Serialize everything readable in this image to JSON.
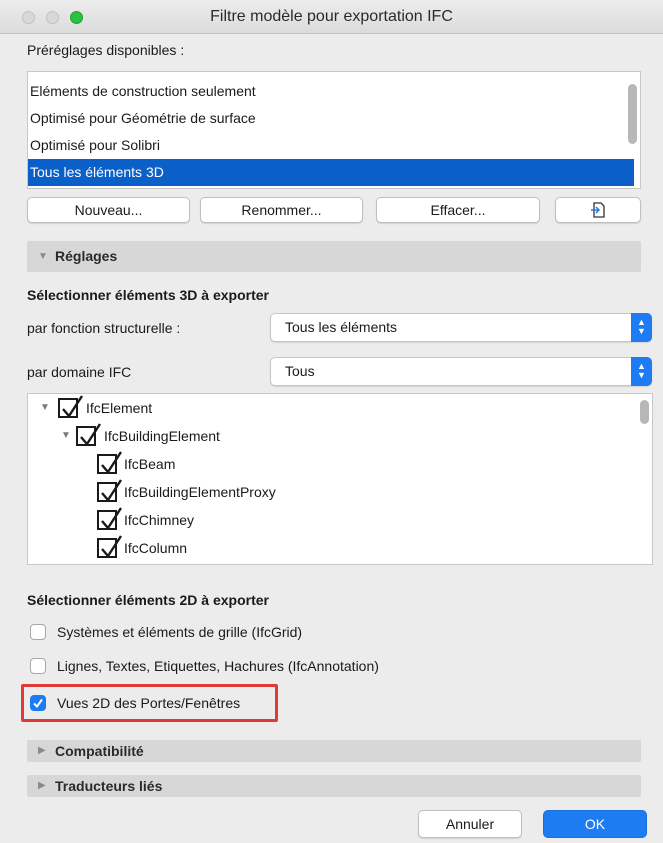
{
  "window": {
    "title": "Filtre modèle pour exportation IFC"
  },
  "presets": {
    "label": "Préréglages disponibles :",
    "items": [
      "Eléments de construction seulement",
      "Optimisé pour Géométrie de surface",
      "Optimisé pour Solibri",
      "Tous les éléments 3D"
    ],
    "selected": "Tous les éléments 3D"
  },
  "buttons": {
    "new": "Nouveau...",
    "rename": "Renommer...",
    "delete": "Effacer...",
    "import_icon": "import-icon"
  },
  "reglages": {
    "title": "Réglages",
    "expanded": true
  },
  "select3d": {
    "heading": "Sélectionner éléments 3D à exporter",
    "structural_label": "par fonction structurelle :",
    "structural_value": "Tous les éléments",
    "domain_label": "par domaine IFC",
    "domain_value": "Tous"
  },
  "tree": {
    "items": [
      {
        "label": "IfcElement",
        "level": 0,
        "expanded": true,
        "checked": true
      },
      {
        "label": "IfcBuildingElement",
        "level": 1,
        "expanded": true,
        "checked": true
      },
      {
        "label": "IfcBeam",
        "level": 2,
        "checked": true
      },
      {
        "label": "IfcBuildingElementProxy",
        "level": 2,
        "checked": true
      },
      {
        "label": "IfcChimney",
        "level": 2,
        "checked": true
      },
      {
        "label": "IfcColumn",
        "level": 2,
        "checked": true
      }
    ]
  },
  "select2d": {
    "heading": "Sélectionner éléments 2D à exporter",
    "options": [
      {
        "label": "Systèmes et éléments de grille (IfcGrid)",
        "checked": false
      },
      {
        "label": "Lignes, Textes, Etiquettes, Hachures (IfcAnnotation)",
        "checked": false
      },
      {
        "label": "Vues 2D des Portes/Fenêtres",
        "checked": true
      }
    ]
  },
  "sections": {
    "compat": "Compatibilité",
    "translators": "Traducteurs liés"
  },
  "footer": {
    "cancel": "Annuler",
    "ok": "OK"
  },
  "colors": {
    "accent": "#1e7cf2",
    "selection": "#0a60c8",
    "highlight": "#e03a36"
  }
}
